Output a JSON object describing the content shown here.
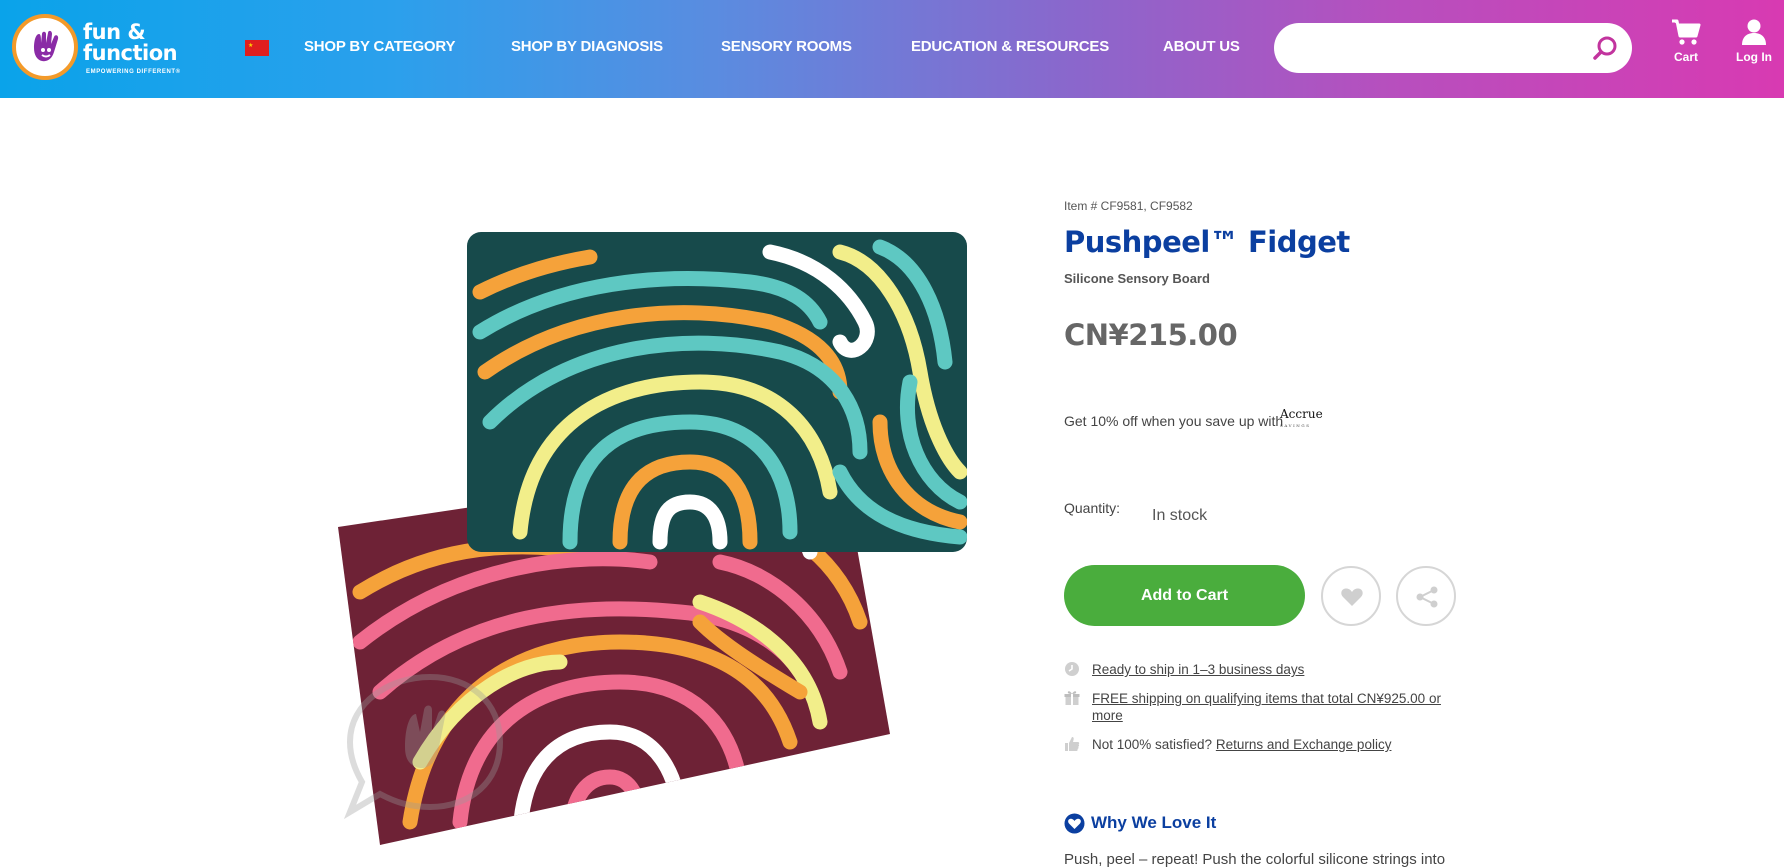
{
  "header": {
    "logo": {
      "name_line1": "fun &",
      "name_line2": "function",
      "tagline": "EMPOWERING DIFFERENT®"
    },
    "nav": [
      {
        "label": "SHOP BY CATEGORY"
      },
      {
        "label": "SHOP BY DIAGNOSIS"
      },
      {
        "label": "SENSORY ROOMS"
      },
      {
        "label": "EDUCATION & RESOURCES"
      },
      {
        "label": "ABOUT US"
      }
    ],
    "search": {
      "placeholder": ""
    },
    "cart_label": "Cart",
    "login_label": "Log In"
  },
  "product": {
    "item_number": "Item # CF9581, CF9582",
    "title": "Pushpeel™ Fidget",
    "subtitle": "Silicone Sensory Board",
    "price": "CN¥215.00",
    "accrue_text": "Get 10% off when you save up with",
    "accrue_logo": "Accrue",
    "accrue_logo_sub": "SAVINGS",
    "quantity_label": "Quantity:",
    "stock_status": "In stock",
    "add_to_cart": "Add to Cart",
    "perks": {
      "ship": "Ready to ship in 1–3 business days",
      "free_line1": "FREE shipping on qualifying items that total CN¥925.00 or",
      "free_line2": "more",
      "satisfied": "Not 100% satisfied?",
      "returns_link": "Returns and Exchange policy"
    },
    "why_heading": "Why We Love It",
    "description": "Push, peel – repeat! Push the colorful silicone strings into"
  },
  "colors": {
    "brand_blue": "#0b3fa0",
    "cart_green": "#4aad3d",
    "logo_orange": "#f39a2a",
    "logo_purple": "#8a2ba6"
  }
}
